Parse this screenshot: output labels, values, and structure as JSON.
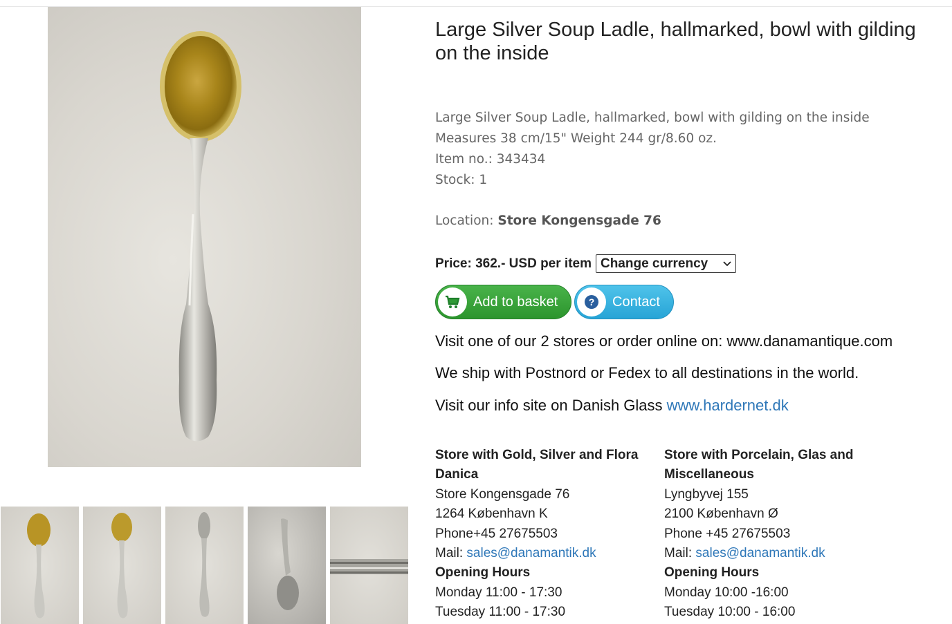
{
  "product": {
    "title": "Large Silver Soup Ladle, hallmarked, bowl with gilding on the inside",
    "description": [
      "Large Silver Soup Ladle, hallmarked, bowl with gilding on the inside",
      "Measures 38 cm/15\" Weight 244 gr/8.60 oz.",
      "Item no.: 343434",
      "Stock: 1"
    ],
    "location_label": "Location:",
    "location_value": "Store Kongensgade 76",
    "price_label": "Price: 362.- USD per item",
    "currency_select": "Change currency"
  },
  "buttons": {
    "add_to_basket": "Add to basket",
    "contact": "Contact"
  },
  "info": {
    "stores_line": "Visit one of our 2 stores or order online on: www.danamantique.com",
    "shipping_line": "We ship with Postnord or Fedex to all destinations in the world.",
    "glass_prefix": "Visit our info site on Danish Glass ",
    "glass_link": "www.hardernet.dk"
  },
  "stores": [
    {
      "name": "Store with Gold, Silver and Flora Danica",
      "address": "Store Kongensgade 76",
      "city": "1264 København K",
      "phone": "Phone+45 27675503",
      "mail_label": "Mail: ",
      "mail": "sales@danamantik.dk",
      "hours_title": "Opening Hours",
      "hours": [
        "Monday 11:00 - 17:30",
        "Tuesday 11:00 - 17:30"
      ]
    },
    {
      "name": "Store with Porcelain, Glas and Miscellaneous",
      "address": "Lyngbyvej 155",
      "city": "2100 København Ø",
      "phone": "Phone +45 27675503",
      "mail_label": "Mail: ",
      "mail": "sales@danamantik.dk",
      "hours_title": "Opening Hours",
      "hours": [
        "Monday 10:00 -16:00",
        "Tuesday 10:00 - 16:00"
      ]
    }
  ],
  "colors": {
    "link": "#2e77b8",
    "basket_button": "#3aa53b",
    "contact_button": "#36b2e0",
    "gold": "#c9a21e",
    "silver": "#b9b8b2"
  },
  "icons": {
    "basket": "cart-icon",
    "contact": "question-icon"
  }
}
